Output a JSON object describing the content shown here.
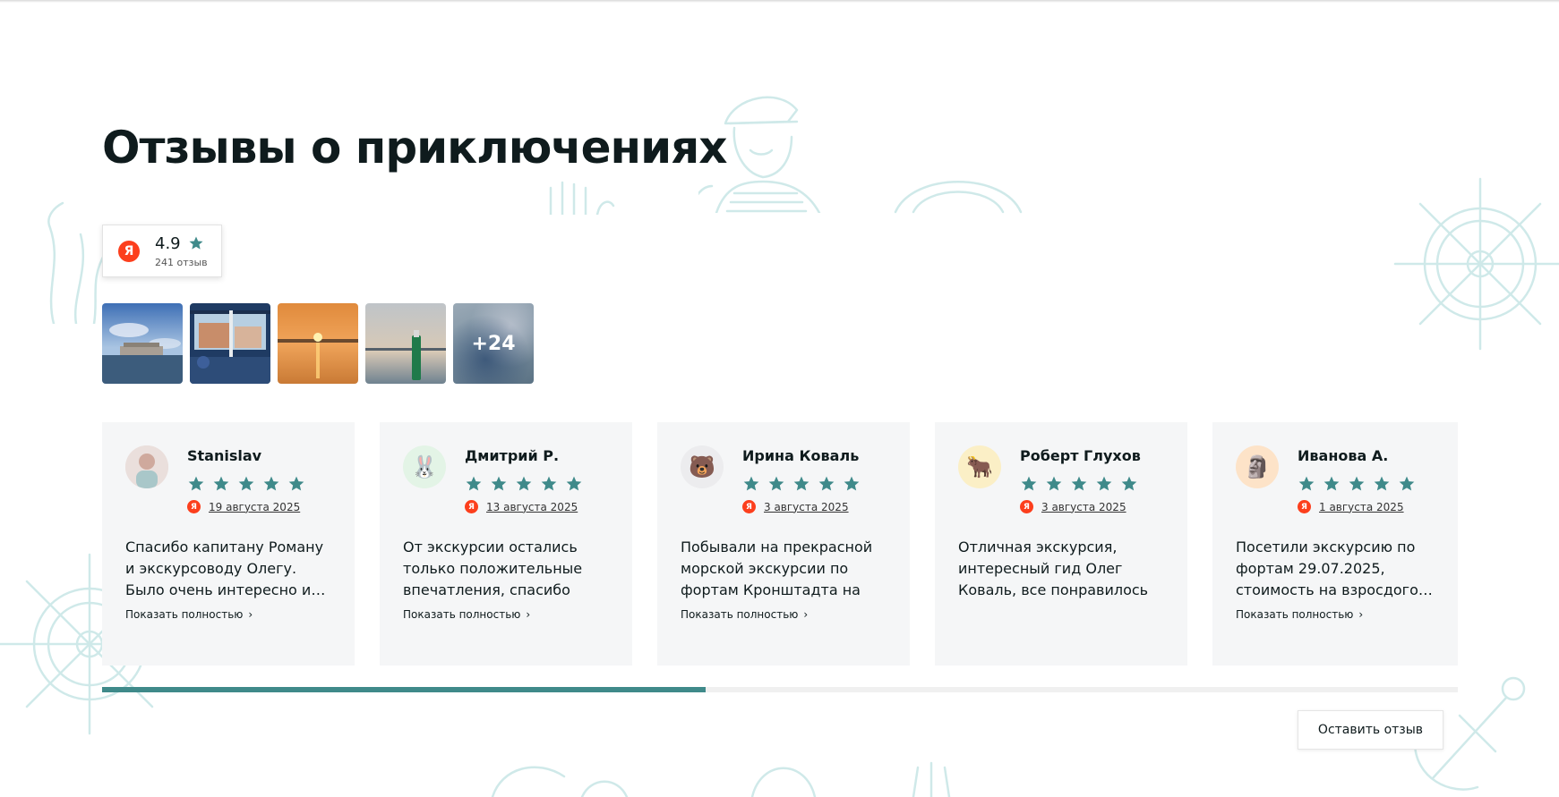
{
  "section": {
    "title": "Отзывы о приключениях"
  },
  "rating": {
    "source_logo_letter": "Я",
    "value": "4.9",
    "count_label": "241 отзыв",
    "star_color": "#3f8a8a"
  },
  "photos": {
    "more_label": "+24"
  },
  "colors": {
    "accent": "#3f8a8a",
    "yandex_red": "#fc3f1d",
    "card_bg": "#f5f6f7"
  },
  "reviews": [
    {
      "author": "Stanislav",
      "avatar_icon": "photo-avatar",
      "rating": 5,
      "date": "19 августа 2025",
      "text": "Спасибо капитану Роману и экскурсоводу Олегу. Было очень интересно и…",
      "show_more": "Показать полностью"
    },
    {
      "author": "Дмитрий Р.",
      "avatar_icon": "rabbit-icon",
      "avatar_glyph": "🐰",
      "rating": 5,
      "date": "13 августа 2025",
      "text": "От экскурсии остались только положительные впечатления, спасибо Олег…",
      "show_more": "Показать полностью"
    },
    {
      "author": "Ирина Коваль",
      "avatar_icon": "bear-icon",
      "avatar_glyph": "🐻",
      "rating": 5,
      "date": "3 августа 2025",
      "text": "Побывали на прекрасной морской экскурсии по фортам Кронштадта на ново…",
      "show_more": "Показать полностью"
    },
    {
      "author": "Роберт Глухов",
      "avatar_icon": "yak-icon",
      "avatar_glyph": "🐂",
      "rating": 5,
      "date": "3 августа 2025",
      "text": "Отличная экскурсия, интересный гид Олег Коваль, все понравилось",
      "show_more": ""
    },
    {
      "author": "Иванова А.",
      "avatar_icon": "moai-icon",
      "avatar_glyph": "🗿",
      "rating": 5,
      "date": "1 августа 2025",
      "text": "Посетили экскурсию по фортам 29.07.2025, стоимость на взросдого…",
      "show_more": "Показать полностью"
    }
  ],
  "carousel": {
    "progress_percent": 44.5
  },
  "actions": {
    "leave_review": "Оставить отзыв"
  }
}
